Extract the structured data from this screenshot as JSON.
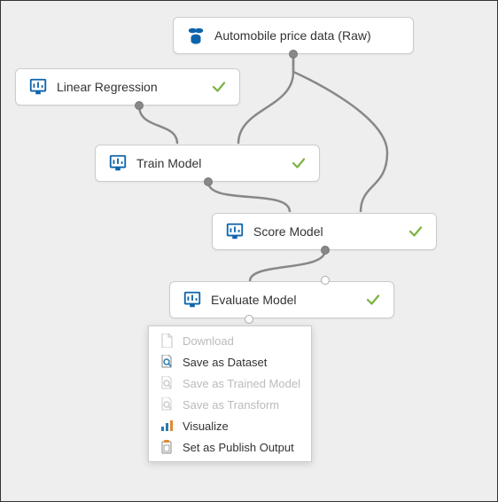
{
  "nodes": {
    "dataset": {
      "label": "Automobile price data (Raw)"
    },
    "linreg": {
      "label": "Linear Regression"
    },
    "train": {
      "label": "Train Model"
    },
    "score": {
      "label": "Score Model"
    },
    "evaluate": {
      "label": "Evaluate Model"
    }
  },
  "menu": {
    "download": "Download",
    "save_dataset": "Save as Dataset",
    "save_trained": "Save as Trained Model",
    "save_transform": "Save as Transform",
    "visualize": "Visualize",
    "publish": "Set as Publish Output"
  },
  "colors": {
    "accent": "#0d64ac",
    "check": "#7cb342",
    "chart_blue": "#2a7ab0",
    "chart_orange": "#e08a2d",
    "connector": "#888"
  }
}
